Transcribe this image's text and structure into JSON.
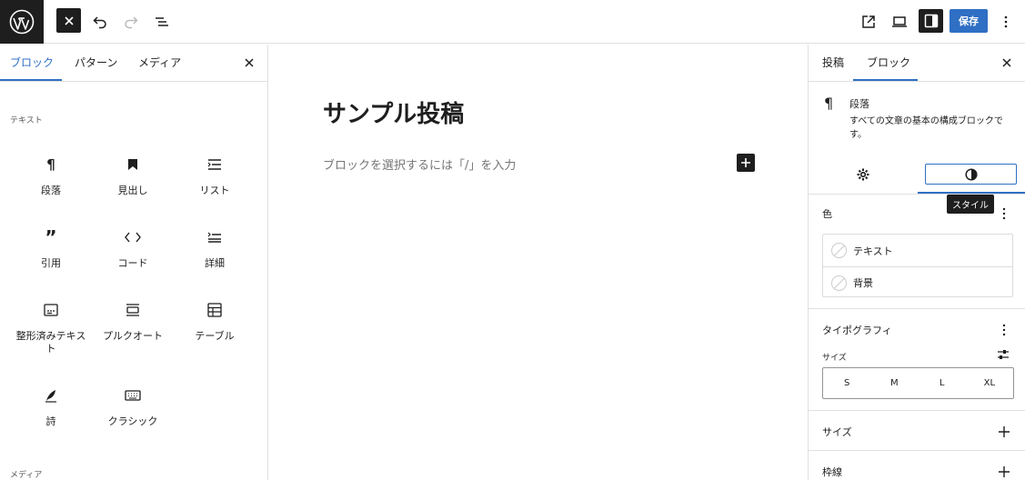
{
  "topbar": {
    "save_label": "保存"
  },
  "inserter": {
    "tabs": [
      {
        "label": "ブロック"
      },
      {
        "label": "パターン"
      },
      {
        "label": "メディア"
      }
    ],
    "category_text": "テキスト",
    "category_media": "メディア",
    "blocks": [
      {
        "label": "段落",
        "icon": "paragraph-icon"
      },
      {
        "label": "見出し",
        "icon": "bookmark-icon"
      },
      {
        "label": "リスト",
        "icon": "list-icon"
      },
      {
        "label": "引用",
        "icon": "quote-icon"
      },
      {
        "label": "コード",
        "icon": "code-icon"
      },
      {
        "label": "詳細",
        "icon": "details-icon"
      },
      {
        "label": "整形済みテキスト",
        "icon": "preformatted-icon"
      },
      {
        "label": "プルクオート",
        "icon": "pullquote-icon"
      },
      {
        "label": "テーブル",
        "icon": "table-icon"
      },
      {
        "label": "詩",
        "icon": "verse-icon"
      },
      {
        "label": "クラシック",
        "icon": "keyboard-icon"
      }
    ]
  },
  "canvas": {
    "title": "サンプル投稿",
    "placeholder": "ブロックを選択するには「/」を入力"
  },
  "settings": {
    "tabs": [
      {
        "label": "投稿"
      },
      {
        "label": "ブロック"
      }
    ],
    "block_name": "段落",
    "block_description": "すべての文章の基本の構成ブロックです。",
    "tooltip": "スタイル",
    "color_section": "色",
    "color_items": [
      {
        "label": "テキスト"
      },
      {
        "label": "背景"
      }
    ],
    "typography_section": "タイポグラフィ",
    "size_label": "サイズ",
    "size_options": [
      "S",
      "M",
      "L",
      "XL"
    ],
    "size_section": "サイズ",
    "border_section": "枠線"
  }
}
